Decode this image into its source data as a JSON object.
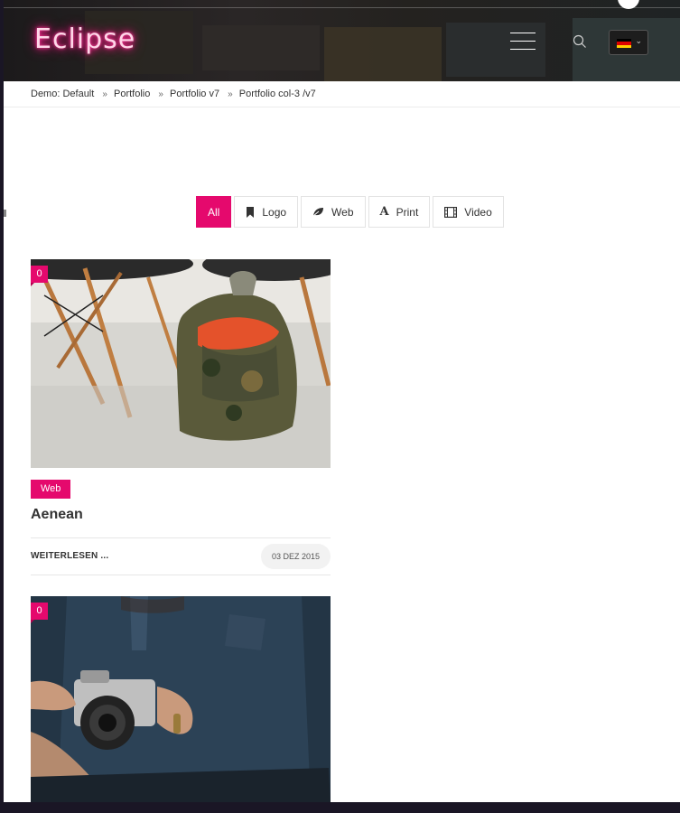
{
  "header": {
    "logo": "Eclipse",
    "flag_colors": [
      "#000000",
      "#dd0000",
      "#ffce00"
    ]
  },
  "breadcrumb": {
    "items": [
      "Demo: Default",
      "Portfolio",
      "Portfolio v7",
      "Portfolio col-3 /v7"
    ],
    "separator": "»"
  },
  "filters": [
    {
      "label": "All",
      "icon": "none",
      "active": true
    },
    {
      "label": "Logo",
      "icon": "bookmark-icon",
      "active": false
    },
    {
      "label": "Web",
      "icon": "leaf-icon",
      "active": false
    },
    {
      "label": "Print",
      "icon": "font-icon",
      "active": false
    },
    {
      "label": "Video",
      "icon": "film-icon",
      "active": false
    }
  ],
  "cards": [
    {
      "count": "0",
      "image": "backpack-photo",
      "tag": "Web",
      "title": "Aenean",
      "read_more": "WEITERLESEN ...",
      "date": "03 DEZ 2015"
    },
    {
      "count": "0",
      "image": "camera-photo"
    }
  ],
  "colors": {
    "accent": "#e5096d",
    "header_bg": "#1f1d1c",
    "desktop_bg": "#1a1625"
  }
}
